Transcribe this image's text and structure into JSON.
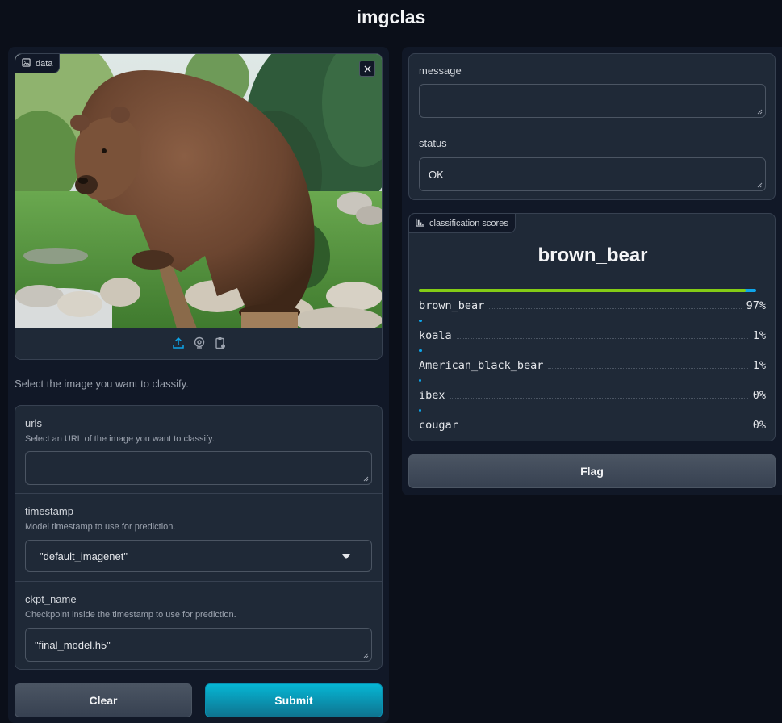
{
  "app": {
    "title": "imgclas"
  },
  "image_input": {
    "label": "data",
    "icons": [
      "upload-icon",
      "webcam-icon",
      "clipboard-icon"
    ]
  },
  "description": "Select the image you want to classify.",
  "params": {
    "urls": {
      "label": "urls",
      "hint": "Select an URL of the image you want to classify.",
      "value": ""
    },
    "timestamp": {
      "label": "timestamp",
      "hint": "Model timestamp to use for prediction.",
      "value": "\"default_imagenet\""
    },
    "ckpt_name": {
      "label": "ckpt_name",
      "hint": "Checkpoint inside the timestamp to use for prediction.",
      "value": "\"final_model.h5\""
    }
  },
  "buttons": {
    "clear": "Clear",
    "submit": "Submit",
    "flag": "Flag"
  },
  "outputs": {
    "message": {
      "label": "message",
      "value": ""
    },
    "status": {
      "label": "status",
      "value": "OK"
    }
  },
  "classification": {
    "label": "classification scores",
    "top_label": "brown_bear",
    "top_fraction": 0.97,
    "scores": [
      {
        "name": "brown_bear",
        "pct": "97%",
        "fraction": 0.97
      },
      {
        "name": "koala",
        "pct": "1%",
        "fraction": 0.01
      },
      {
        "name": "American_black_bear",
        "pct": "1%",
        "fraction": 0.01
      },
      {
        "name": "ibex",
        "pct": "0%",
        "fraction": 0.003
      },
      {
        "name": "cougar",
        "pct": "0%",
        "fraction": 0.003
      }
    ]
  },
  "colors": {
    "accent": "#0ea5e9",
    "submit_top": "#06b6d4",
    "submit_bottom": "#0e7490",
    "confidence": "#84cc16"
  }
}
